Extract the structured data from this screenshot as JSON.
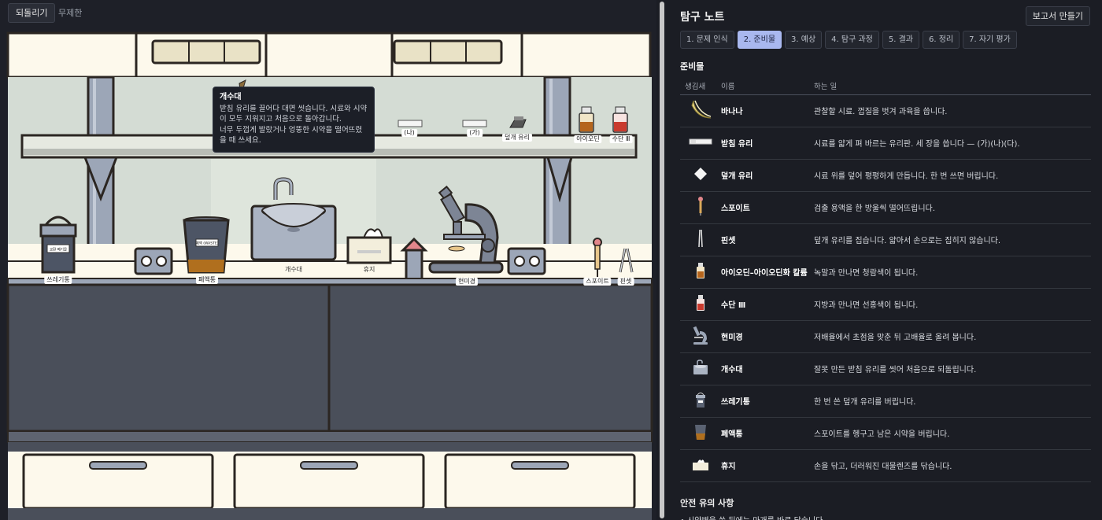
{
  "toolbar": {
    "undo_label": "되돌리기",
    "mode_label": "무제한"
  },
  "scene": {
    "labels": {
      "slide_na": "(나)",
      "slide_ga": "(가)",
      "cover_glass": "덮개 유리",
      "iodine": "아이오딘",
      "sudan": "수단 Ⅲ",
      "trash": "쓰레기통",
      "waste": "폐액통",
      "sink": "개수대",
      "tissue": "휴지",
      "microscope": "현미경",
      "dropper": "스포이트",
      "tweezers": "핀셋"
    },
    "trash_sign": "교환 폐기물",
    "waste_sign": "폐액 (WASTE)",
    "tooltip": {
      "title": "개수대",
      "line1": "받침 유리를 끌어다 대면 씻습니다. 시료와 시약이 모두 지워지고 처음으로 돌아갑니다.",
      "line2": "너무 두껍게 발랐거나 엉뚱한 시약을 떨어뜨렸을 때 쓰세요."
    }
  },
  "note": {
    "title": "탐구 노트",
    "report_button": "보고서 만들기",
    "tabs": [
      "1. 문제 인식",
      "2. 준비물",
      "3. 예상",
      "4. 탐구 과정",
      "5. 결과",
      "6. 정리",
      "7. 자기 평가"
    ],
    "active_tab": 1,
    "section_title": "준비물",
    "columns": [
      "생김새",
      "이름",
      "하는 일"
    ],
    "items": [
      {
        "icon": "banana-icon",
        "name": "바나나",
        "role": "관찰할 시료. 껍질을 벗겨 과육을 씁니다."
      },
      {
        "icon": "slide-glass-icon",
        "name": "받침 유리",
        "role": "시료를 얇게 펴 바르는 유리판. 세 장을 씁니다 — (가)(나)(다)."
      },
      {
        "icon": "cover-glass-icon",
        "name": "덮개 유리",
        "role": "시료 위를 덮어 평평하게 만듭니다. 한 번 쓰면 버립니다."
      },
      {
        "icon": "dropper-icon",
        "name": "스포이트",
        "role": "검출 용액을 한 방울씩 떨어뜨립니다."
      },
      {
        "icon": "tweezers-icon",
        "name": "핀셋",
        "role": "덮개 유리를 집습니다. 얇아서 손으로는 집히지 않습니다."
      },
      {
        "icon": "iodine-bottle-icon",
        "name": "아이오딘–아이오딘화 칼륨",
        "role": "녹말과 만나면 청람색이 됩니다."
      },
      {
        "icon": "sudan-bottle-icon",
        "name": "수단 Ⅲ",
        "role": "지방과 만나면 선홍색이 됩니다."
      },
      {
        "icon": "microscope-icon",
        "name": "현미경",
        "role": "저배율에서 초점을 맞춘 뒤 고배율로 올려 봅니다."
      },
      {
        "icon": "sink-icon",
        "name": "개수대",
        "role": "잘못 만든 받침 유리를 씻어 처음으로 되돌립니다."
      },
      {
        "icon": "trash-icon",
        "name": "쓰레기통",
        "role": "한 번 쓴 덮개 유리를 버립니다."
      },
      {
        "icon": "waste-bin-icon",
        "name": "폐액통",
        "role": "스포이트를 헹구고 남은 시약을 버립니다."
      },
      {
        "icon": "tissue-icon",
        "name": "휴지",
        "role": "손을 닦고, 더러워진 대물렌즈를 닦습니다."
      }
    ],
    "safety_title": "안전 유의 사항",
    "safety_first": "• 시약병을 쓴 뒤에는 마개를 바로 닫습니다."
  }
}
